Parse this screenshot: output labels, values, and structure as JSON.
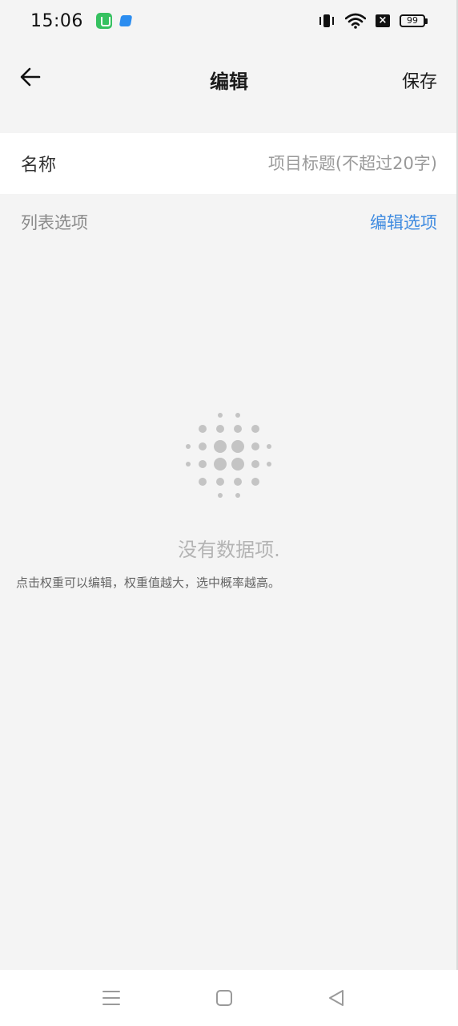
{
  "status_bar": {
    "time": "15:06",
    "battery": "99",
    "icons": [
      "app-notification-green",
      "app-notification-blue",
      "vibrate-icon",
      "wifi-icon",
      "no-sim-icon",
      "battery-icon"
    ]
  },
  "header": {
    "title": "编辑",
    "save_label": "保存",
    "back_icon": "arrow-left-icon"
  },
  "name_field": {
    "label": "名称",
    "value": "",
    "placeholder": "项目标题(不超过20字)"
  },
  "list_section": {
    "label": "列表选项",
    "edit_label": "编辑选项"
  },
  "empty_state": {
    "icon": "dot-grid-icon",
    "text": "没有数据项.",
    "hint": "点击权重可以编辑，权重值越大，选中概率越高。"
  },
  "nav_bar": {
    "icons": [
      "menu-icon",
      "home-icon",
      "back-triangle-icon"
    ]
  },
  "colors": {
    "background": "#f4f4f4",
    "accent": "#3f8be0",
    "muted": "#8a8a8a",
    "empty_gray": "#c4c4c4"
  }
}
